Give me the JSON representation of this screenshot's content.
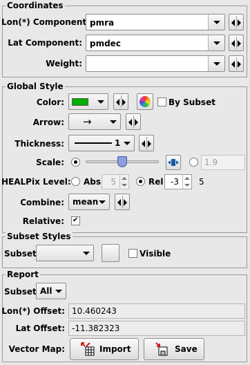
{
  "coordinates": {
    "title": "Coordinates",
    "lon_label": "Lon(*) Component:",
    "lon_value": "pmra",
    "lat_label": "Lat Component:",
    "lat_value": "pmdec",
    "weight_label": "Weight:",
    "weight_value": ""
  },
  "global_style": {
    "title": "Global Style",
    "color_label": "Color:",
    "color_value": "#00b000",
    "by_subset_label": "By Subset",
    "arrow_label": "Arrow:",
    "arrow_value": "→",
    "thickness_label": "Thickness:",
    "thickness_value": "1",
    "scale_label": "Scale:",
    "scale_value": "1.9",
    "scale_slider_fraction": 0.5,
    "healpix_label": "HEALPix Level:",
    "abs_label": "Abs",
    "abs_value": "5",
    "rel_label": "Rel",
    "rel_value": "-3",
    "rel_result": "5",
    "combine_label": "Combine:",
    "combine_value": "mean",
    "relative_label": "Relative:",
    "relative_mark": "✔"
  },
  "subset_styles": {
    "title": "Subset Styles",
    "subset_label": "Subset:",
    "subset_value": "",
    "visible_label": "Visible"
  },
  "report": {
    "title": "Report",
    "subset_label": "Subset:",
    "subset_value": "All",
    "lon_offset_label": "Lon(*) Offset:",
    "lon_offset_value": "10.460243",
    "lat_offset_label": "Lat Offset:",
    "lat_offset_value": "-11.382323",
    "vector_map_label": "Vector Map:",
    "import_label": "Import",
    "save_label": "Save"
  },
  "colors": {
    "panel_bg": "#e8e8e8",
    "accent_red": "#d01818",
    "slider_thumb": "#8a9ee0"
  }
}
